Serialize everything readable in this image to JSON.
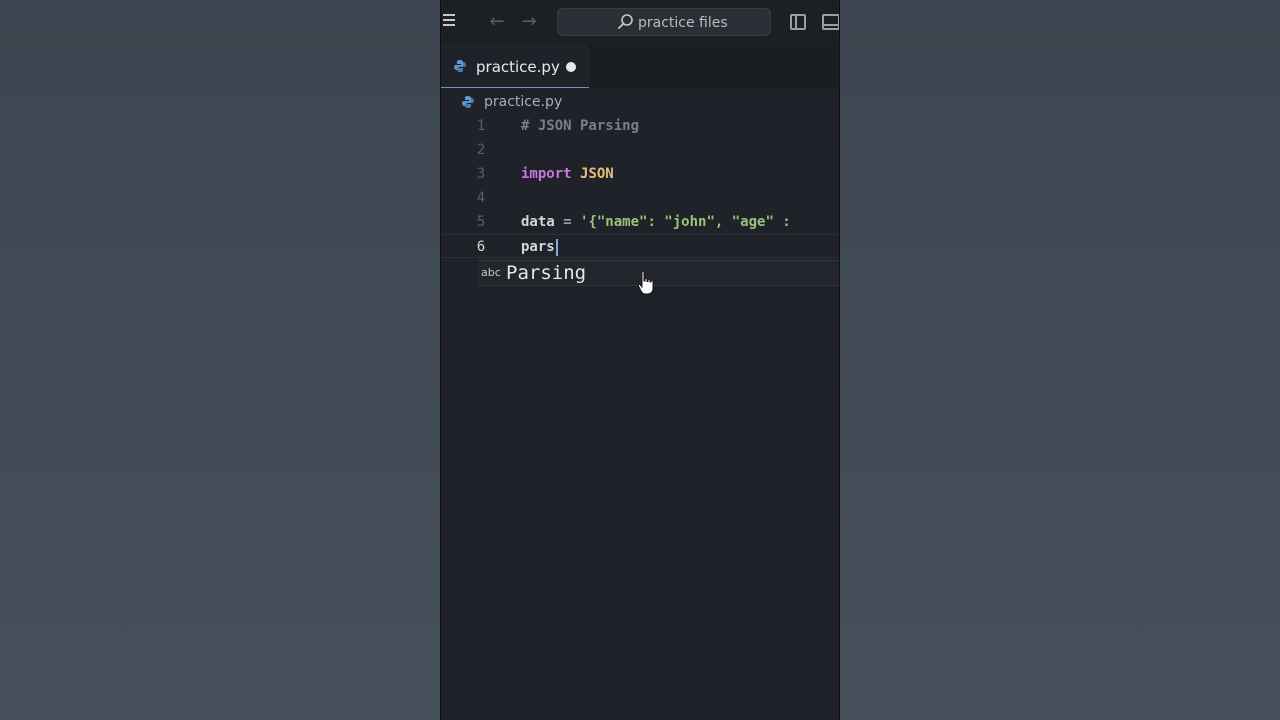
{
  "titlebar": {
    "search_text": "practice files"
  },
  "tabs": [
    {
      "label": "practice.py",
      "dirty": true
    }
  ],
  "breadcrumb": {
    "label": "practice.py"
  },
  "editor": {
    "lines": [
      {
        "number": "1",
        "tokens": [
          {
            "t": "# JSON Parsing",
            "c": "comment"
          }
        ]
      },
      {
        "number": "2",
        "tokens": []
      },
      {
        "number": "3",
        "tokens": [
          {
            "t": "import",
            "c": "kw"
          },
          {
            "t": " ",
            "c": "var"
          },
          {
            "t": "JSON",
            "c": "mod"
          }
        ]
      },
      {
        "number": "4",
        "tokens": []
      },
      {
        "number": "5",
        "tokens": [
          {
            "t": "data",
            "c": "var"
          },
          {
            "t": " = ",
            "c": "op"
          },
          {
            "t": "'{\"name\": \"john\", \"age\" : ",
            "c": "str"
          }
        ]
      },
      {
        "number": "6",
        "tokens": [
          {
            "t": "pars",
            "c": "var"
          }
        ],
        "active": true
      }
    ]
  },
  "suggestion": {
    "kind": "abc",
    "label": "Parsing"
  },
  "colors": {
    "keyword": "#c678dd",
    "module": "#e5c07b",
    "string": "#98c379",
    "accent": "#6f8fbf"
  }
}
